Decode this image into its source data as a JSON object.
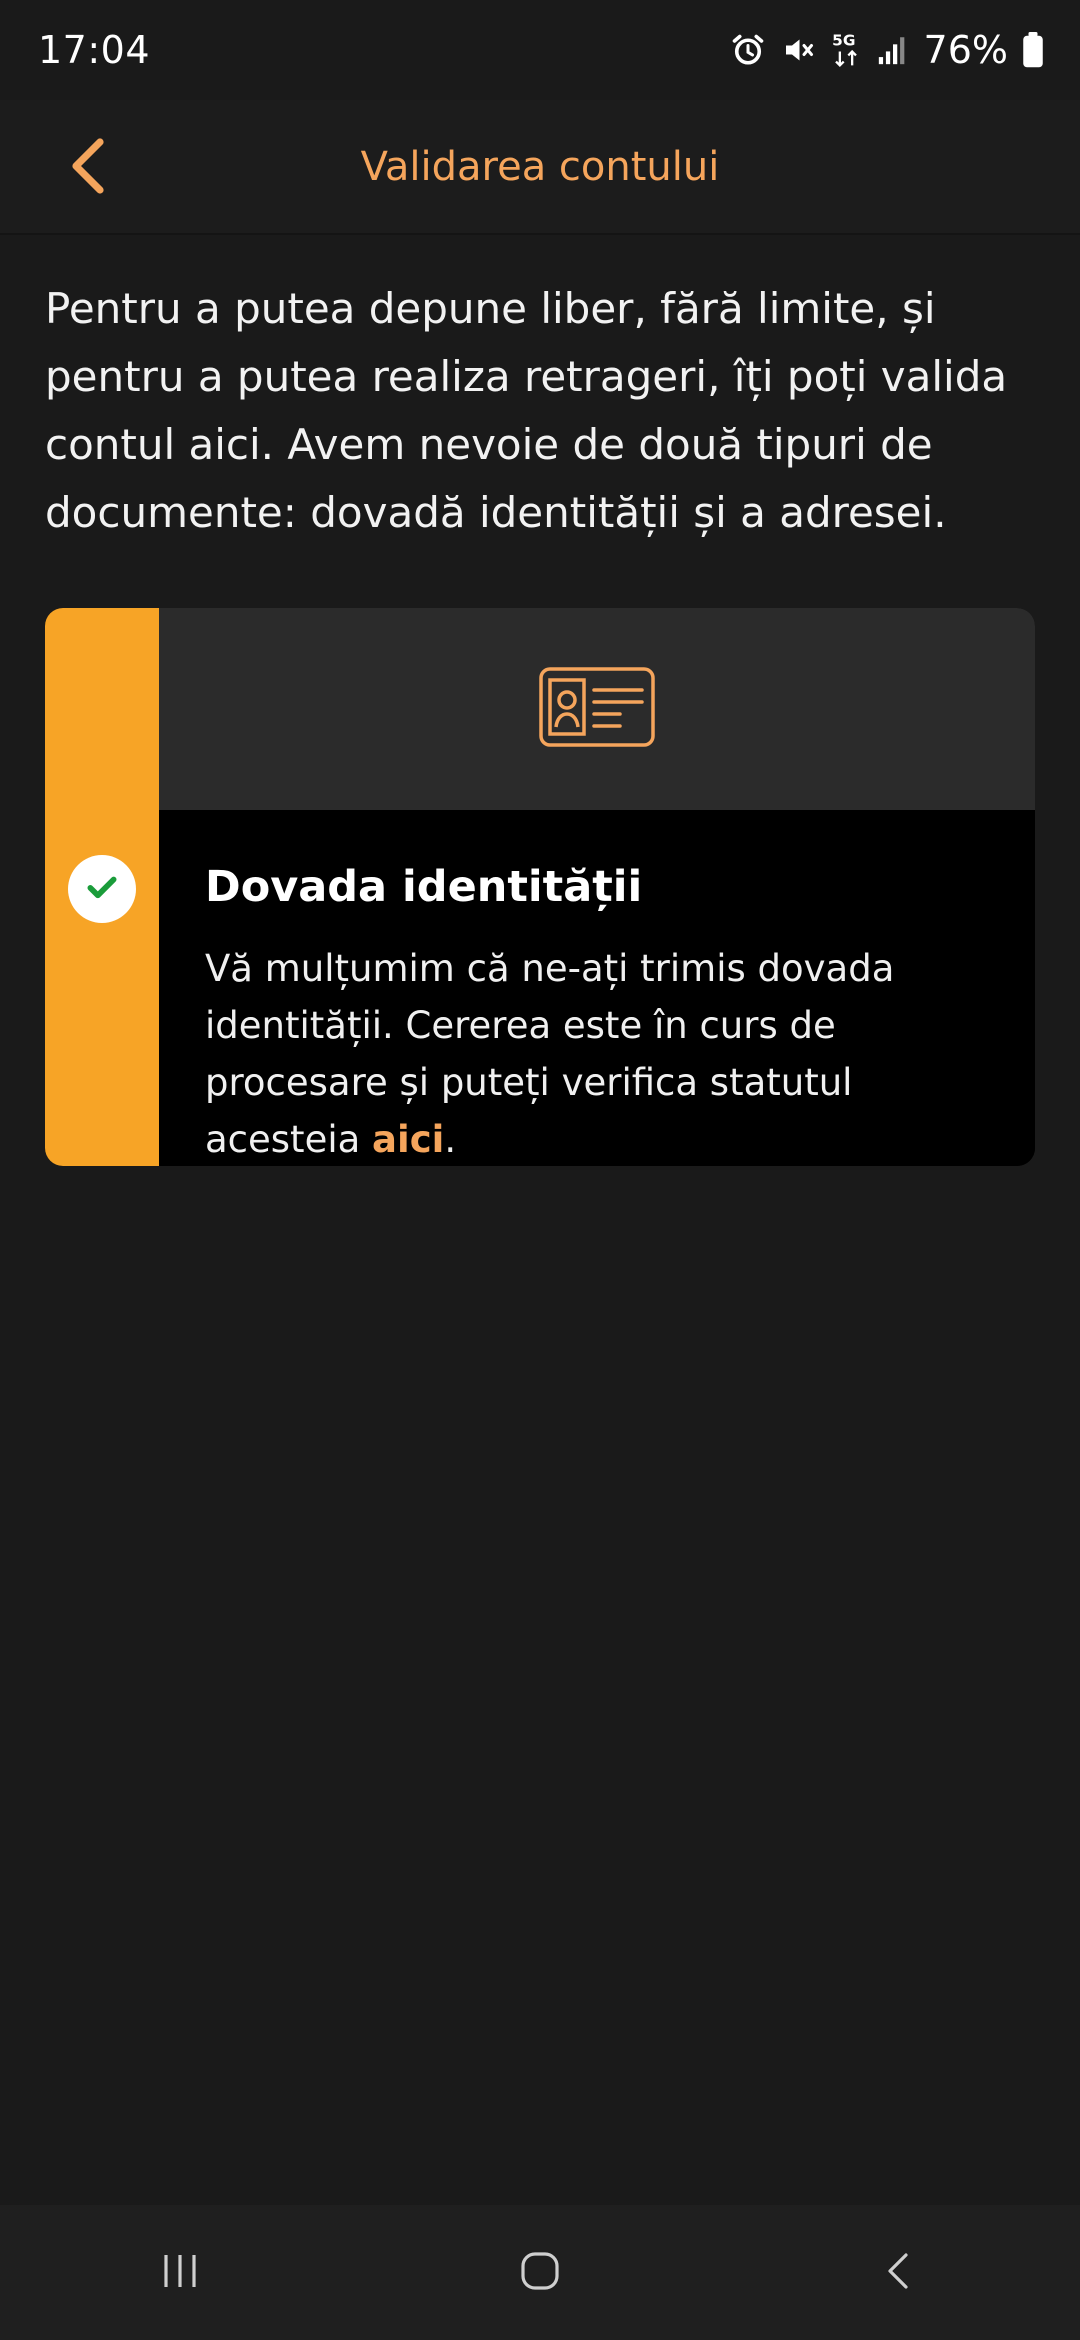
{
  "status_bar": {
    "time": "17:04",
    "battery": "76%",
    "icons": [
      "alarm-icon",
      "mute-icon",
      "5g-icon",
      "signal-icon",
      "battery-icon"
    ]
  },
  "header": {
    "title": "Validarea contului",
    "back_icon": "chevron-left-icon"
  },
  "intro": {
    "text": "Pentru a putea depune liber, fără limite, și pentru a putea realiza retrageri, îți poți valida contul aici. Avem nevoie de două tipuri de documente: dovadă identității și a adresei."
  },
  "identity_card": {
    "icon": "id-card-icon",
    "status_icon": "check-icon",
    "title": "Dovada identității",
    "description": "Vă mulțumim că ne-ați trimis dovada identității. Cererea este în curs de procesare și puteți verifica statutul acesteia ",
    "link_text": "aici",
    "description_end": "."
  },
  "colors": {
    "accent": "#f5a55c",
    "card_accent": "#f7a426",
    "background": "#1a1a1a",
    "success": "#1a9c3a"
  },
  "nav": {
    "icons": [
      "recent-apps-icon",
      "home-icon",
      "back-icon"
    ]
  }
}
